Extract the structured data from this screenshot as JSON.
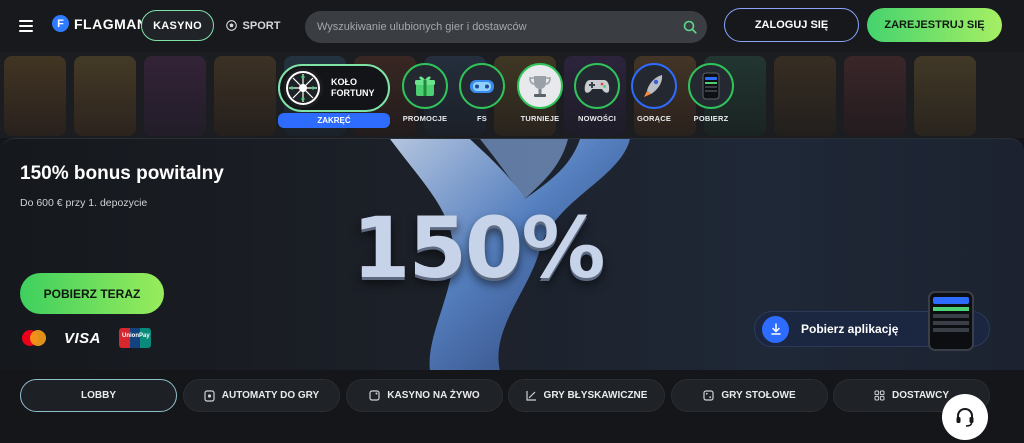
{
  "header": {
    "logo_text": "FLAGMAN",
    "logo_letter": "F",
    "nav": {
      "casino": "KASYNO",
      "sport": "SPORT"
    },
    "search": {
      "placeholder": "Wyszukiwanie ulubionych gier i dostawców"
    },
    "login_label": "ZALOGUJ SIĘ",
    "register_label": "ZAREJESTRUJ SIĘ"
  },
  "categories": {
    "wheel": {
      "line1": "KOŁO",
      "line2": "FORTUNY",
      "button": "ZAKRĘĆ"
    },
    "items": [
      {
        "label": "PROMOCJE",
        "icon": "gift-icon",
        "ring": "#2fc35a"
      },
      {
        "label": "FS",
        "icon": "controller-icon",
        "ring": "#2fc35a"
      },
      {
        "label": "TURNIEJE",
        "icon": "trophy-icon",
        "ring": "#2fc35a"
      },
      {
        "label": "NOWOŚCI",
        "icon": "gamepad-icon",
        "ring": "#2fc35a"
      },
      {
        "label": "GORĄCE",
        "icon": "rocket-icon",
        "ring": "#2f6bff"
      },
      {
        "label": "POBIERZ",
        "icon": "phone-icon",
        "ring": "#2fc35a"
      }
    ]
  },
  "hero": {
    "title": "150% bonus powitalny",
    "subtitle": "Do 600 € przy 1. depozycie",
    "cta": "POBIERZ TERAZ",
    "big_number": "150%",
    "payments": {
      "visa": "VISA",
      "unionpay": "UnionPay"
    },
    "app_label": "Pobierz aplikację"
  },
  "tabs": [
    {
      "label": "LOBBY",
      "icon": ""
    },
    {
      "label": "AUTOMATY DO GRY",
      "icon": "slot-icon"
    },
    {
      "label": "KASYNO NA ŻYWO",
      "icon": "live-icon"
    },
    {
      "label": "GRY BŁYSKAWICZNE",
      "icon": "chart-icon"
    },
    {
      "label": "GRY STOŁOWE",
      "icon": "dice-icon"
    },
    {
      "label": "DOSTAWCY",
      "icon": "grid-icon"
    }
  ],
  "colors": {
    "accent_green": "#45d36e",
    "accent_blue": "#2e6cff",
    "background": "#141619"
  }
}
